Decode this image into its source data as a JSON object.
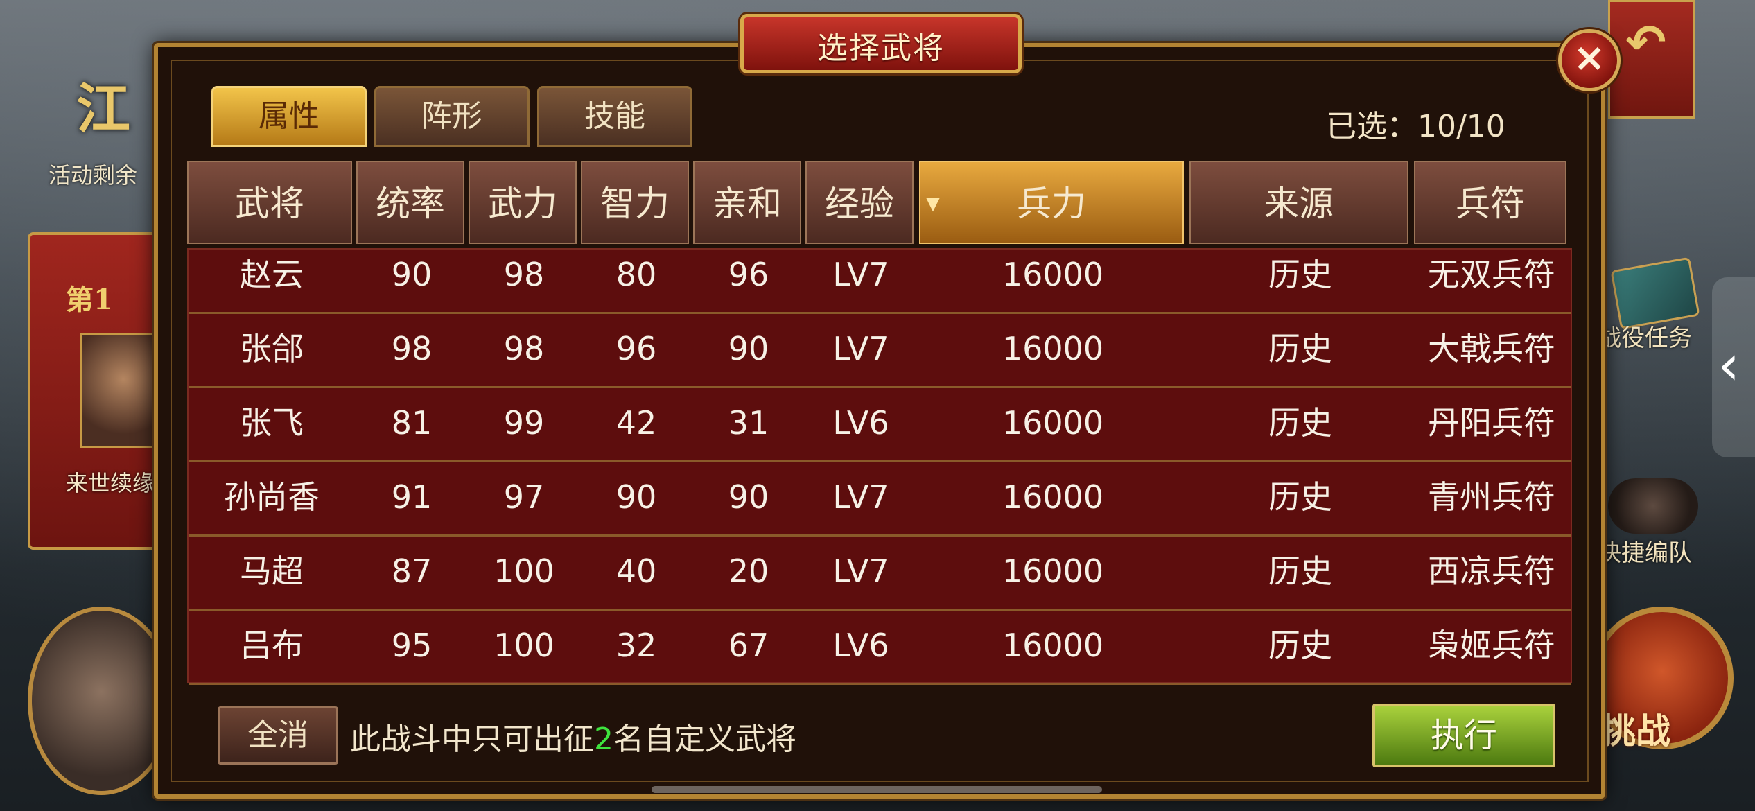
{
  "background": {
    "title_partial": "江",
    "activity_partial": "活动剩余",
    "banner_rank_partial": "第1",
    "banner_caption_partial": "来世续缘",
    "campaign_label_partial": "战役任务",
    "quick_label_partial": "快捷编队",
    "challenge_label_partial": "挑战"
  },
  "dialog": {
    "title": "选择武将",
    "close_icon": "×",
    "tabs": [
      "属性",
      "阵形",
      "技能"
    ],
    "active_tab": "属性",
    "selected_label": "已选：10/10"
  },
  "table": {
    "headers": [
      "武将",
      "统率",
      "武力",
      "智力",
      "亲和",
      "经验",
      "兵力",
      "来源",
      "兵符"
    ],
    "sorted_column": "兵力",
    "rows": [
      [
        "赵云",
        "90",
        "98",
        "80",
        "96",
        "LV7",
        "16000",
        "历史",
        "无双兵符"
      ],
      [
        "张郃",
        "98",
        "98",
        "96",
        "90",
        "LV7",
        "16000",
        "历史",
        "大戟兵符"
      ],
      [
        "张飞",
        "81",
        "99",
        "42",
        "31",
        "LV6",
        "16000",
        "历史",
        "丹阳兵符"
      ],
      [
        "孙尚香",
        "91",
        "97",
        "90",
        "90",
        "LV7",
        "16000",
        "历史",
        "青州兵符"
      ],
      [
        "马超",
        "87",
        "100",
        "40",
        "20",
        "LV7",
        "16000",
        "历史",
        "西凉兵符"
      ],
      [
        "吕布",
        "95",
        "100",
        "32",
        "67",
        "LV6",
        "16000",
        "历史",
        "枭姬兵符"
      ]
    ]
  },
  "footer": {
    "clear_label": "全消",
    "hint_prefix": "此战斗中只可出征",
    "hint_number": "2",
    "hint_suffix": "名自定义武将",
    "execute_label": "执行"
  },
  "colors": {
    "dialog_bg": "#201109",
    "table_bg": "#5d0d0d",
    "gold_border": "#b38433",
    "sorted_header": "#e8a93f",
    "execute_green": "#7fa823",
    "hint_number": "#3ee23e"
  }
}
